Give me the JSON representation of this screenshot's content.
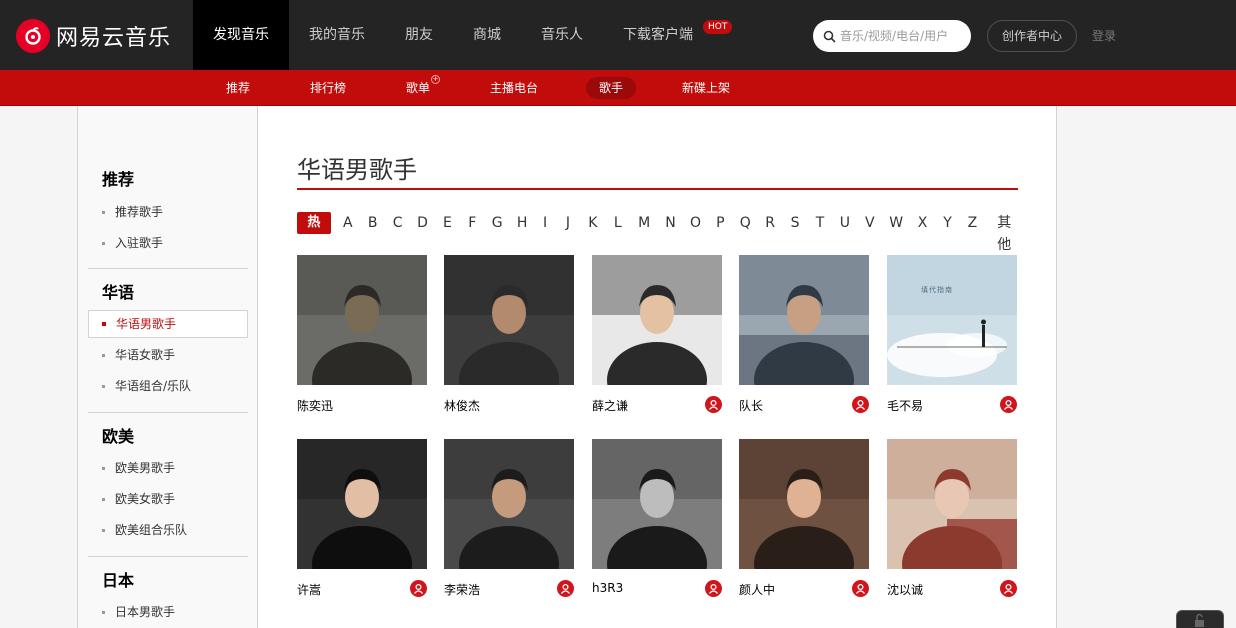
{
  "brand": {
    "name": "网易云音乐",
    "accent": "#c20c0c"
  },
  "topnav": {
    "items": [
      {
        "label": "发现音乐",
        "active": true
      },
      {
        "label": "我的音乐"
      },
      {
        "label": "朋友"
      },
      {
        "label": "商城"
      },
      {
        "label": "音乐人"
      },
      {
        "label": "下载客户端",
        "badge": "HOT"
      }
    ],
    "search_placeholder": "音乐/视频/电台/用户",
    "creator_label": "创作者中心",
    "login_label": "登录"
  },
  "subnav": {
    "items": [
      {
        "label": "推荐"
      },
      {
        "label": "排行榜"
      },
      {
        "label": "歌单",
        "dot": "+"
      },
      {
        "label": "主播电台"
      },
      {
        "label": "歌手",
        "active": true
      },
      {
        "label": "新碟上架"
      }
    ]
  },
  "sidebar": {
    "groups": [
      {
        "title": "推荐",
        "items": [
          {
            "label": "推荐歌手"
          },
          {
            "label": "入驻歌手"
          }
        ]
      },
      {
        "title": "华语",
        "items": [
          {
            "label": "华语男歌手",
            "active": true
          },
          {
            "label": "华语女歌手"
          },
          {
            "label": "华语组合/乐队"
          }
        ]
      },
      {
        "title": "欧美",
        "items": [
          {
            "label": "欧美男歌手"
          },
          {
            "label": "欧美女歌手"
          },
          {
            "label": "欧美组合乐队"
          }
        ]
      },
      {
        "title": "日本",
        "items": [
          {
            "label": "日本男歌手"
          }
        ]
      }
    ]
  },
  "main": {
    "title": "华语男歌手",
    "letters": [
      "热门",
      "A",
      "B",
      "C",
      "D",
      "E",
      "F",
      "G",
      "H",
      "I",
      "J",
      "K",
      "L",
      "M",
      "N",
      "O",
      "P",
      "Q",
      "R",
      "S",
      "T",
      "U",
      "V",
      "W",
      "X",
      "Y",
      "Z",
      "其他"
    ],
    "artists": [
      {
        "name": "陈奕迅",
        "has_profile": false
      },
      {
        "name": "林俊杰",
        "has_profile": false
      },
      {
        "name": "薛之谦",
        "has_profile": true
      },
      {
        "name": "队长",
        "has_profile": true
      },
      {
        "name": "毛不易",
        "has_profile": true
      },
      {
        "name": "许嵩",
        "has_profile": true
      },
      {
        "name": "李荣浩",
        "has_profile": true
      },
      {
        "name": "h3R3",
        "has_profile": true
      },
      {
        "name": "颜人中",
        "has_profile": true
      },
      {
        "name": "沈以诚",
        "has_profile": true
      }
    ],
    "album_overlay": "填代指南"
  }
}
